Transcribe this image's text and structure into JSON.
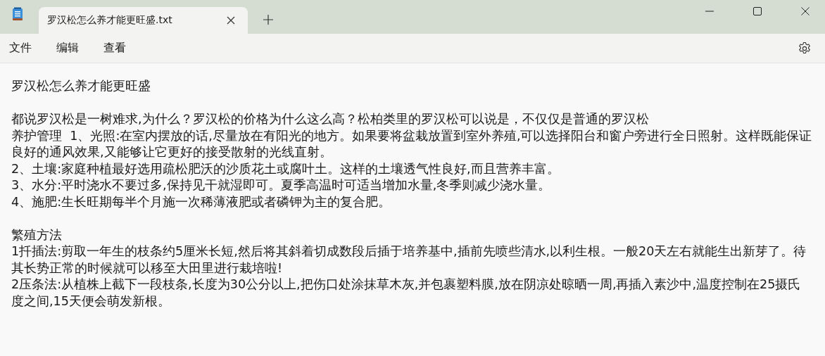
{
  "window": {
    "tab_title": "罗汉松怎么养才能更旺盛.txt",
    "tab_selected": true
  },
  "menu": [
    "文件",
    "编辑",
    "查看"
  ],
  "paragraphs": [
    [
      "罗汉松怎么养才能更旺盛"
    ],
    [
      "都说罗汉松是一树难求,为什么？罗汉松的价格为什么这么高？松柏类里的罗汉松可以说是，不仅仅是普通的罗汉松",
      "养护管理  1、光照:在室内摆放的话,尽量放在有阳光的地方。如果要将盆栽放置到室外养殖,可以选择阳台和窗户旁进行全日照射。这样既能保证",
      "良好的通风效果,又能够让它更好的接受散射的光线直射。",
      "2、土壤:家庭种植最好选用疏松肥沃的沙质花土或腐叶土。这样的土壤透气性良好,而且营养丰富。",
      "3、水分:平时浇水不要过多,保持见干就湿即可。夏季高温时可适当增加水量,冬季则减少浇水量。",
      "4、施肥:生长旺期每半个月施一次稀薄液肥或者磷钾为主的复合肥。"
    ],
    [
      "繁殖方法",
      "1扦插法:剪取一年生的枝条约5厘米长短,然后将其斜着切成数段后插于培养基中,插前先喷些清水,以利生根。一般20天左右就能生出新芽了。待",
      "其长势正常的时候就可以移至大田里进行栽培啦!",
      "2压条法:从植株上截下一段枝条,长度为30公分以上,把伤口处涂抹草木灰,并包裹塑料膜,放在阴凉处晾晒一周,再插入素沙中,温度控制在25摄氏",
      "度之间,15天便会萌发新根。"
    ]
  ]
}
